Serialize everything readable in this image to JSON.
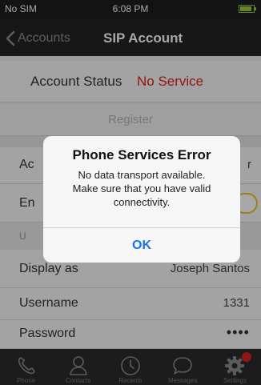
{
  "status_bar": {
    "carrier": "No SIM",
    "time": "6:08 PM",
    "battery_level": 0.85,
    "battery_color": "#9ccb3b"
  },
  "nav": {
    "back_label": "Accounts",
    "title": "SIP Account"
  },
  "account_status": {
    "label": "Account Status",
    "value": "No Service",
    "value_color": "#e02020"
  },
  "register_label": "Register",
  "rows": {
    "account": {
      "label_visible": "Ac",
      "value_visible": "r"
    },
    "enabled": {
      "label_visible": "En"
    },
    "section_header": "U",
    "display_as": {
      "label": "Display as",
      "value": "Joseph Santos"
    },
    "username": {
      "label": "Username",
      "value": "1331"
    },
    "password": {
      "label": "Password",
      "value": "••••"
    }
  },
  "tabs": [
    {
      "label": "Phone",
      "icon": "phone-icon"
    },
    {
      "label": "Contacts",
      "icon": "contacts-icon"
    },
    {
      "label": "Recents",
      "icon": "clock-icon"
    },
    {
      "label": "Messages",
      "icon": "chat-icon"
    },
    {
      "label": "Settings",
      "icon": "gear-icon",
      "badge": true
    }
  ],
  "alert": {
    "title": "Phone Services Error",
    "message_lines": [
      "No data transport available.",
      "Make sure that you have valid",
      "connectivity."
    ],
    "button": "OK"
  },
  "colors": {
    "accent": "#1a74e8",
    "error": "#e02020",
    "toggle_ring": "#f0c030"
  }
}
